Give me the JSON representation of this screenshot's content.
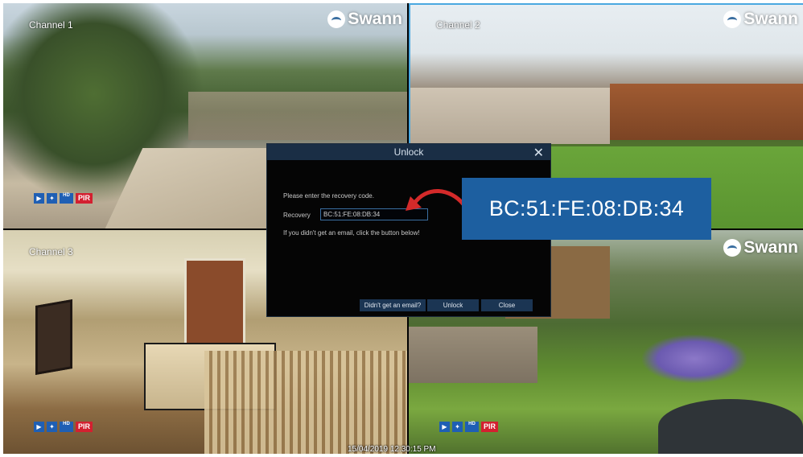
{
  "tiles": [
    {
      "label": "Channel 1",
      "brand": "Swann",
      "icons": {
        "hd": "HD",
        "pir": "PIR"
      }
    },
    {
      "label": "Channel 2",
      "brand": "Swann"
    },
    {
      "label": "Channel 3",
      "icons": {
        "hd": "HD",
        "pir": "PIR"
      }
    },
    {
      "label": "",
      "brand": "Swann",
      "icons": {
        "hd": "HD",
        "pir": "PIR"
      }
    }
  ],
  "dialog": {
    "title": "Unlock",
    "prompt": "Please enter the recovery code.",
    "recovery_label": "Recovery",
    "recovery_value": "BC:51:FE:08:DB:34",
    "hint": "If you didn't get an email, click the button below!",
    "buttons": {
      "email": "Didn't get an email?",
      "unlock": "Unlock",
      "close": "Close"
    }
  },
  "callout": {
    "text": "BC:51:FE:08:DB:34"
  },
  "timestamp": "15/04/2019 12:30:15 PM",
  "colors": {
    "dialog_header": "#1a2e45",
    "button": "#1b3553",
    "callout_bg": "#1d5fa0",
    "pir": "#d32030",
    "arrow": "#d42a2a",
    "selected_border": "#4aa8e0"
  },
  "icons": [
    "close-icon",
    "camera-icon",
    "motion-icon",
    "hd-1080p-badge",
    "pir-badge",
    "swann-logo-icon",
    "arrow-icon"
  ]
}
